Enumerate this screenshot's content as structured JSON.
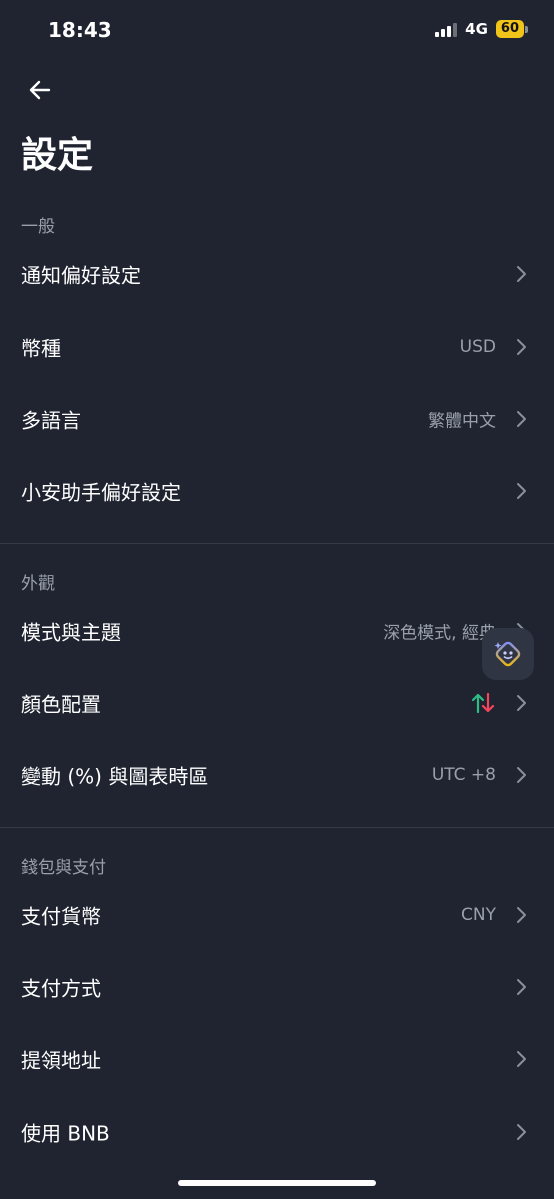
{
  "status": {
    "time": "18:43",
    "network": "4G",
    "battery": "60"
  },
  "page_title": "設定",
  "sections": [
    {
      "header": "一般",
      "rows": [
        {
          "label": "通知偏好設定",
          "value": ""
        },
        {
          "label": "幣種",
          "value": "USD"
        },
        {
          "label": "多語言",
          "value": "繁體中文"
        },
        {
          "label": "小安助手偏好設定",
          "value": ""
        }
      ]
    },
    {
      "header": "外觀",
      "rows": [
        {
          "label": "模式與主題",
          "value": "深色模式, 經典"
        },
        {
          "label": "顏色配置",
          "value": ""
        },
        {
          "label": "變動 (%) 與圖表時區",
          "value": "UTC +8"
        }
      ]
    },
    {
      "header": "錢包與支付",
      "rows": [
        {
          "label": "支付貨幣",
          "value": "CNY"
        },
        {
          "label": "支付方式",
          "value": ""
        },
        {
          "label": "提領地址",
          "value": ""
        },
        {
          "label": "使用 BNB",
          "value": ""
        }
      ]
    }
  ],
  "colors": {
    "up": "#2ebd85",
    "down": "#f6465d",
    "background": "#1f2430",
    "chevron": "#8a9099"
  },
  "icons": {
    "back": "arrow-left-icon",
    "chevron": "chevron-right-icon",
    "assistant": "assistant-bot-icon",
    "color_scheme": "up-down-arrows-icon"
  }
}
